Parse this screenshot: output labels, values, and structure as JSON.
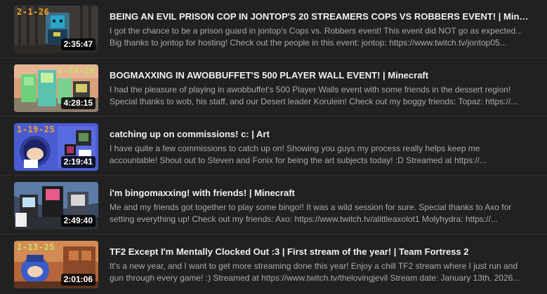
{
  "videos": [
    {
      "date_overlay": "2-1-26",
      "duration": "2:35:47",
      "title": "BEING AN EVIL PRISON COP IN JONTOP'S 20 STREAMERS COPS VS ROBBERS EVENT! | Minecraft",
      "desc_line1": "I got the chance to be a prison guard in jontop's Cops vs. Robbers event! This event did NOT go as expected...",
      "desc_line2": "Big thanks to jontop for hosting! Check out the people in this event: jontop: https://www.twitch.tv/jontop05..."
    },
    {
      "date_overlay": "1-24-26",
      "duration": "4:28:15",
      "title": "BOGMAXXING IN AWOBBUFFET'S 500 PLAYER WALL EVENT! | Minecraft",
      "desc_line1": "I had the pleasure of playing in awobbuffet's 500 Player Walls event with some friends in the dessert region!",
      "desc_line2": "Special thanks to wob, his staff, and our Desert leader Korulein! Check out my boggy friends: Topaz: https://..."
    },
    {
      "date_overlay": "1-19-25",
      "duration": "2:19:41",
      "title": "catching up on commissions! c: | Art",
      "desc_line1": "I have quite a few commissions to catch up on! Showing you guys my process really helps keep me",
      "desc_line2": "accountable! Shout out to Steven and Fonix for being the art subjects today! :D Streamed at https://..."
    },
    {
      "date_overlay": "",
      "duration": "2:49:40",
      "title": "i'm bingomaxxing! with friends! | Minecraft",
      "desc_line1": "Me and my friends got together to play some bingo!! It was a wild session for sure. Special thanks to Axo for",
      "desc_line2": "setting everything up! Check out my friends: Axo: https://www.twitch.tv/alittleaxolot1 Molyhydra: https://..."
    },
    {
      "date_overlay": "1-13-25",
      "duration": "2:01:06",
      "title": "TF2 Except I'm Mentally Clocked Out :3 | First stream of the year! | Team Fortress 2",
      "desc_line1": "It's a new year, and I want to get more streaming done this year! Enjoy a chill TF2 stream where I just run and",
      "desc_line2": "gun through every game! :) Streamed at https://www.twitch.tv/thelovingjevil Stream date: January 13th. 2026..."
    }
  ],
  "colors": {
    "background": "#212121",
    "title": "#f1f1f1",
    "description": "#aaaaaa",
    "date_overlay_orange": "#f5a623",
    "date_overlay_green": "#c8e26a"
  }
}
